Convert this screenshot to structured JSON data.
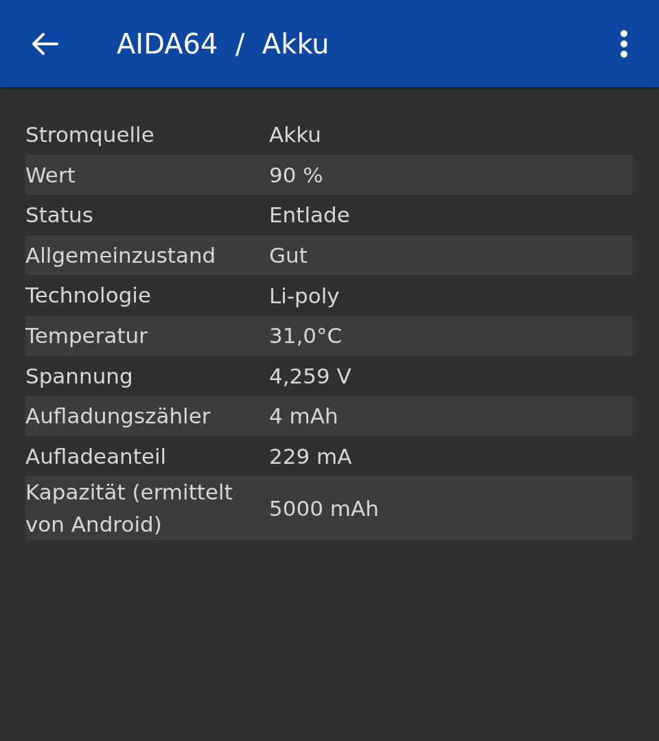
{
  "app_bar": {
    "title": "AIDA64  /  Akku"
  },
  "rows": [
    {
      "label": "Stromquelle",
      "value": "Akku"
    },
    {
      "label": "Wert",
      "value": "90 %"
    },
    {
      "label": "Status",
      "value": "Entlade"
    },
    {
      "label": "Allgemeinzustand",
      "value": "Gut"
    },
    {
      "label": "Technologie",
      "value": "Li-poly"
    },
    {
      "label": "Temperatur",
      "value": "31,0°C"
    },
    {
      "label": "Spannung",
      "value": "4,259 V"
    },
    {
      "label": "Aufladungszähler",
      "value": "4 mAh"
    },
    {
      "label": "Aufladeanteil",
      "value": "229 mA"
    },
    {
      "label": "Kapazität (ermittelt von Android)",
      "value": "5000 mAh"
    }
  ]
}
